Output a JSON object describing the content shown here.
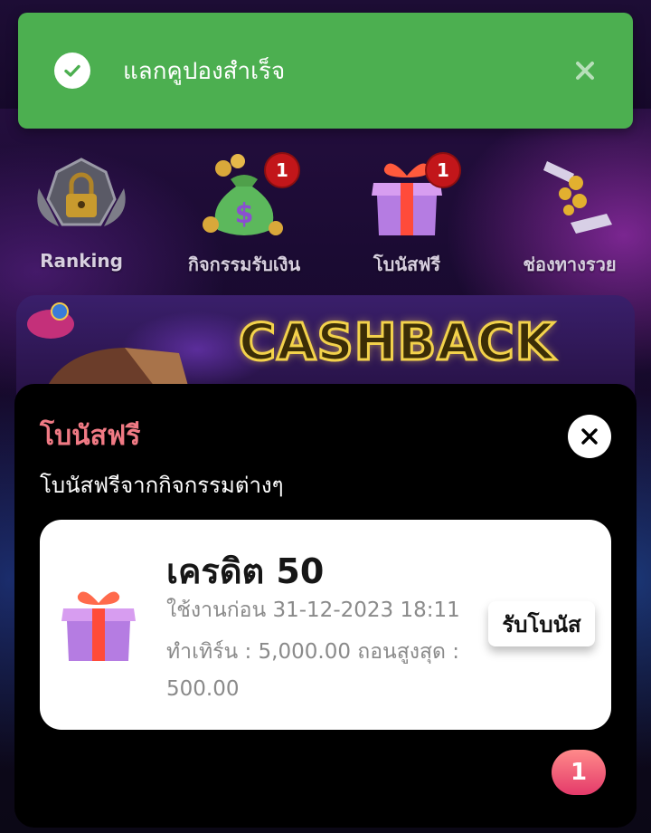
{
  "toast": {
    "message": "แลกคูปองสำเร็จ",
    "success_color": "#4caf50"
  },
  "categories": [
    {
      "label": "Ranking",
      "icon": "lock-ranking-icon",
      "badge": ""
    },
    {
      "label": "กิจกรรมรับเงิน",
      "icon": "money-bag-icon",
      "badge": "1"
    },
    {
      "label": "โบนัสฟรี",
      "icon": "gift-box-icon",
      "badge": "1"
    },
    {
      "label": "ช่องทางรวย",
      "icon": "coins-hand-icon",
      "badge": ""
    }
  ],
  "banner": {
    "text": "CASHBACK"
  },
  "sheet": {
    "title": "โบนัสฟรี",
    "subtitle": "โบนัสฟรีจากกิจกรรมต่างๆ",
    "title_color": "#f07a84",
    "card": {
      "credit": "เครดิต 50",
      "expires": "ใช้งานก่อน 31-12-2023 18:11",
      "turnover": "ทำเทิร์น : 5,000.00  ถอนสูงสุด :",
      "max_withdraw": "500.00",
      "claim_label": "รับโบนัส"
    },
    "page_badge": "1"
  }
}
